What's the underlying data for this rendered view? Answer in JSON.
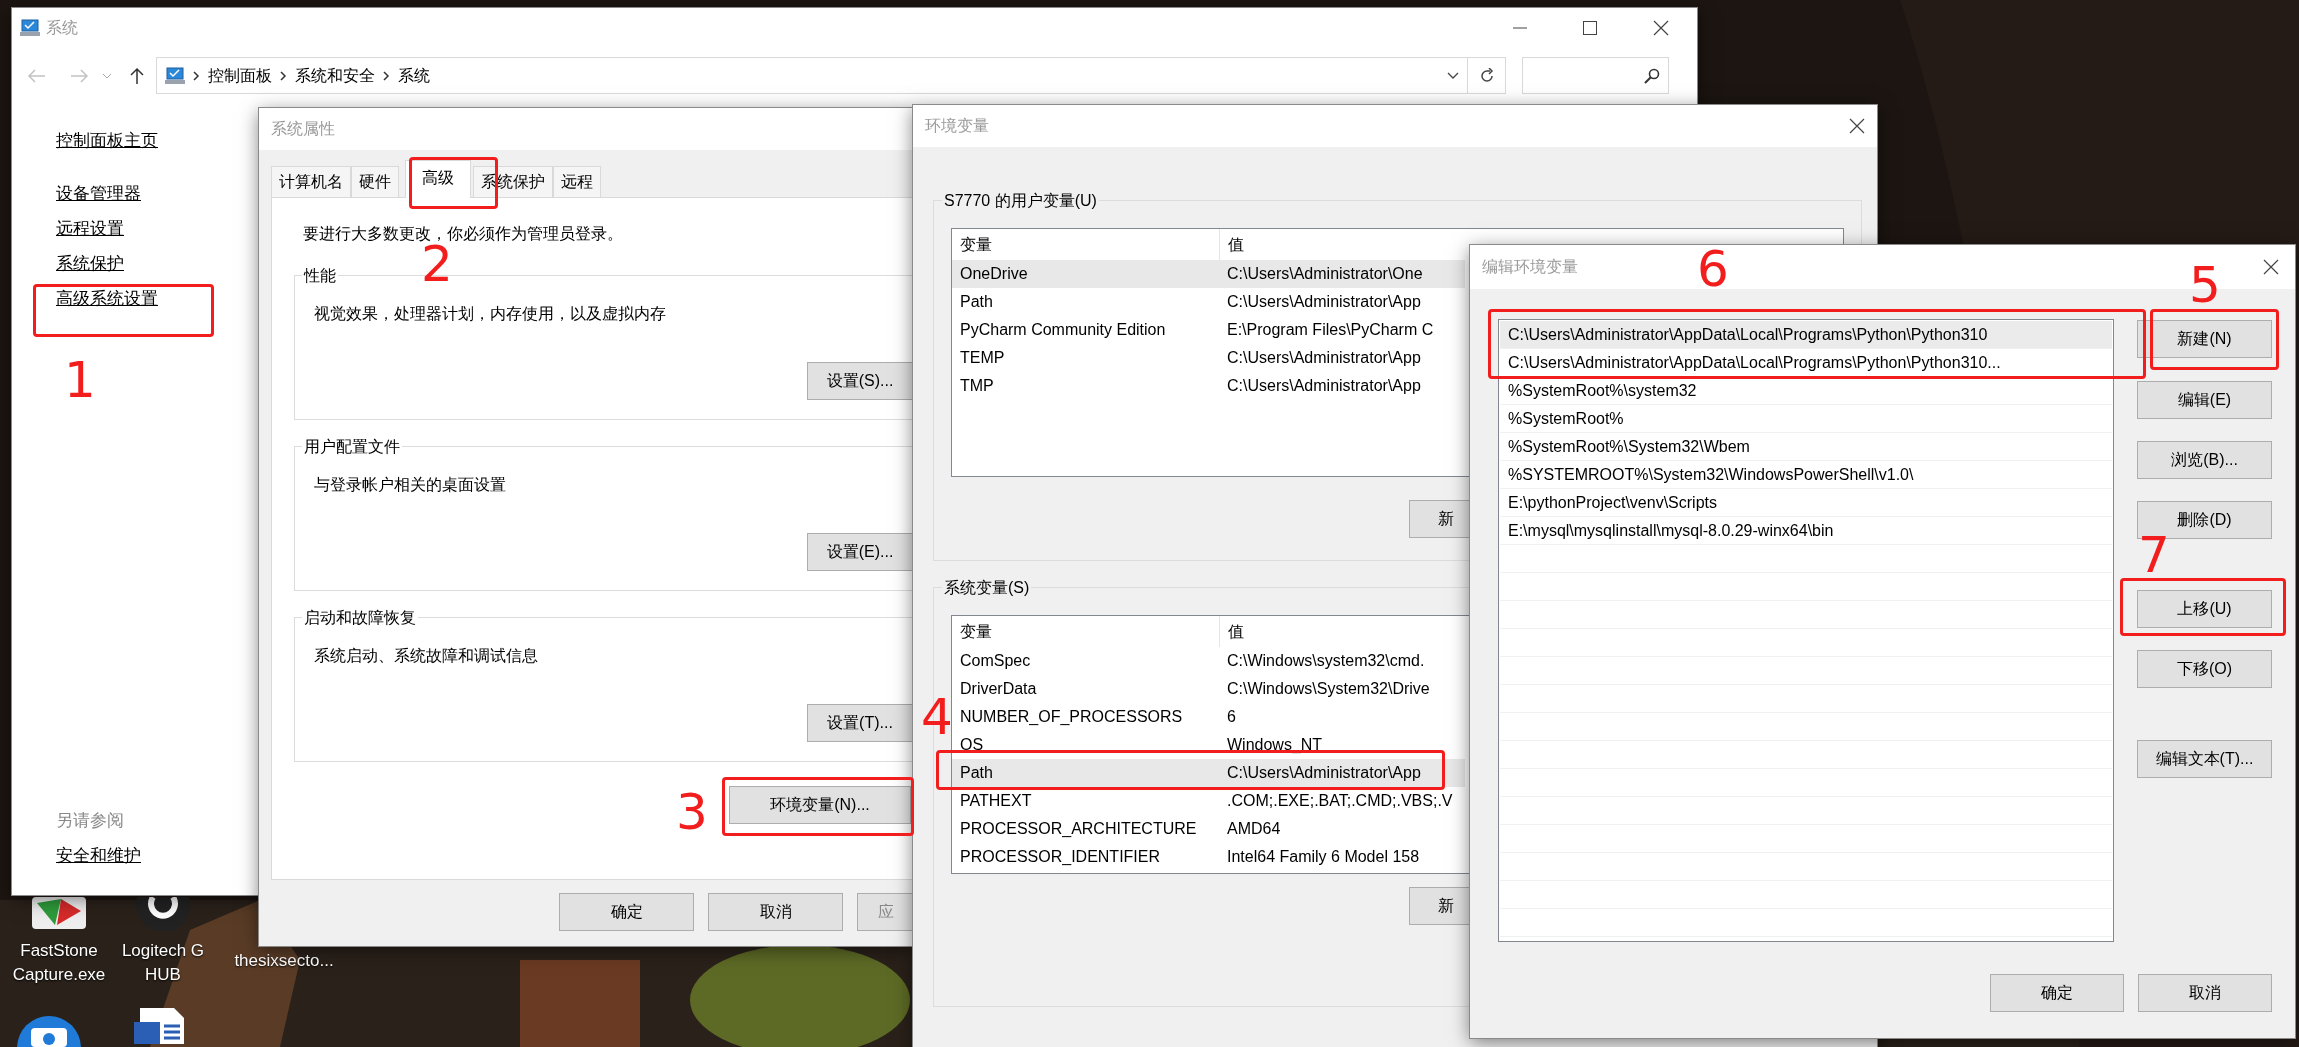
{
  "system_window": {
    "title": "系统",
    "breadcrumb": [
      "控制面板",
      "系统和安全",
      "系统"
    ],
    "nav_links": [
      "控制面板主页",
      "设备管理器",
      "远程设置",
      "系统保护",
      "高级系统设置"
    ],
    "see_also_heading": "另请参阅",
    "see_also_links": [
      "安全和维护"
    ]
  },
  "system_properties": {
    "title": "系统属性",
    "tabs": [
      {
        "label": "计算机名",
        "selected": false
      },
      {
        "label": "硬件",
        "selected": false
      },
      {
        "label": "高级",
        "selected": true
      },
      {
        "label": "系统保护",
        "selected": false
      },
      {
        "label": "远程",
        "selected": false
      }
    ],
    "notice": "要进行大多数更改，你必须作为管理员登录。",
    "groups": [
      {
        "title": "性能",
        "description": "视觉效果，处理器计划，内存使用，以及虚拟内存",
        "button": "设置(S)..."
      },
      {
        "title": "用户配置文件",
        "description": "与登录帐户相关的桌面设置",
        "button": "设置(E)..."
      },
      {
        "title": "启动和故障恢复",
        "description": "系统启动、系统故障和调试信息",
        "button": "设置(T)..."
      }
    ],
    "env_button": "环境变量(N)...",
    "footer_buttons": [
      "确定",
      "取消",
      "应"
    ]
  },
  "environment_variables": {
    "title": "环境变量",
    "user_vars": {
      "title": "S7770 的用户变量(U)",
      "columns": [
        "变量",
        "值"
      ],
      "rows": [
        {
          "name": "OneDrive",
          "value": "C:\\Users\\Administrator\\One",
          "selected": true
        },
        {
          "name": "Path",
          "value": "C:\\Users\\Administrator\\App",
          "selected": false
        },
        {
          "name": "PyCharm Community Edition",
          "value": "E:\\Program Files\\PyCharm C",
          "selected": false
        },
        {
          "name": "TEMP",
          "value": "C:\\Users\\Administrator\\App",
          "selected": false
        },
        {
          "name": "TMP",
          "value": "C:\\Users\\Administrator\\App",
          "selected": false
        }
      ],
      "button": "新"
    },
    "system_vars": {
      "title": "系统变量(S)",
      "columns": [
        "变量",
        "值"
      ],
      "rows": [
        {
          "name": "ComSpec",
          "value": "C:\\Windows\\system32\\cmd.",
          "selected": false
        },
        {
          "name": "DriverData",
          "value": "C:\\Windows\\System32\\Drive",
          "selected": false
        },
        {
          "name": "NUMBER_OF_PROCESSORS",
          "value": "6",
          "selected": false
        },
        {
          "name": "OS",
          "value": "Windows_NT",
          "selected": false
        },
        {
          "name": "Path",
          "value": "C:\\Users\\Administrator\\App",
          "selected": true
        },
        {
          "name": "PATHEXT",
          "value": ".COM;.EXE;.BAT;.CMD;.VBS;.V",
          "selected": false
        },
        {
          "name": "PROCESSOR_ARCHITECTURE",
          "value": "AMD64",
          "selected": false
        },
        {
          "name": "PROCESSOR_IDENTIFIER",
          "value": "Intel64 Family 6 Model 158",
          "selected": false
        }
      ],
      "button": "新"
    }
  },
  "edit_dialog": {
    "title": "编辑环境变量",
    "entries": [
      {
        "text": "C:\\Users\\Administrator\\AppData\\Local\\Programs\\Python\\Python310",
        "selected": true
      },
      {
        "text": "C:\\Users\\Administrator\\AppData\\Local\\Programs\\Python\\Python310...",
        "selected": false
      },
      {
        "text": "%SystemRoot%\\system32",
        "selected": false
      },
      {
        "text": "%SystemRoot%",
        "selected": false
      },
      {
        "text": "%SystemRoot%\\System32\\Wbem",
        "selected": false
      },
      {
        "text": "%SYSTEMROOT%\\System32\\WindowsPowerShell\\v1.0\\",
        "selected": false
      },
      {
        "text": "E:\\pythonProject\\venv\\Scripts",
        "selected": false
      },
      {
        "text": "E:\\mysql\\mysqlinstall\\mysql-8.0.29-winx64\\bin",
        "selected": false
      }
    ],
    "buttons": [
      "新建(N)",
      "编辑(E)",
      "浏览(B)...",
      "删除(D)",
      "上移(U)",
      "下移(O)",
      "编辑文本(T)..."
    ],
    "footer_buttons": [
      "确定",
      "取消"
    ]
  },
  "desktop_icons": [
    {
      "label": "FastStone Capture.exe",
      "kind": "faststone"
    },
    {
      "label": "Logitech G HUB",
      "kind": "logitech"
    },
    {
      "label": "thesixsecto..."
    },
    {
      "kind": "camera"
    },
    {
      "kind": "word"
    }
  ],
  "annotations": [
    {
      "label": "1"
    },
    {
      "label": "2"
    },
    {
      "label": "3"
    },
    {
      "label": "4"
    },
    {
      "label": "6"
    },
    {
      "label": "5"
    },
    {
      "label": "7"
    }
  ]
}
